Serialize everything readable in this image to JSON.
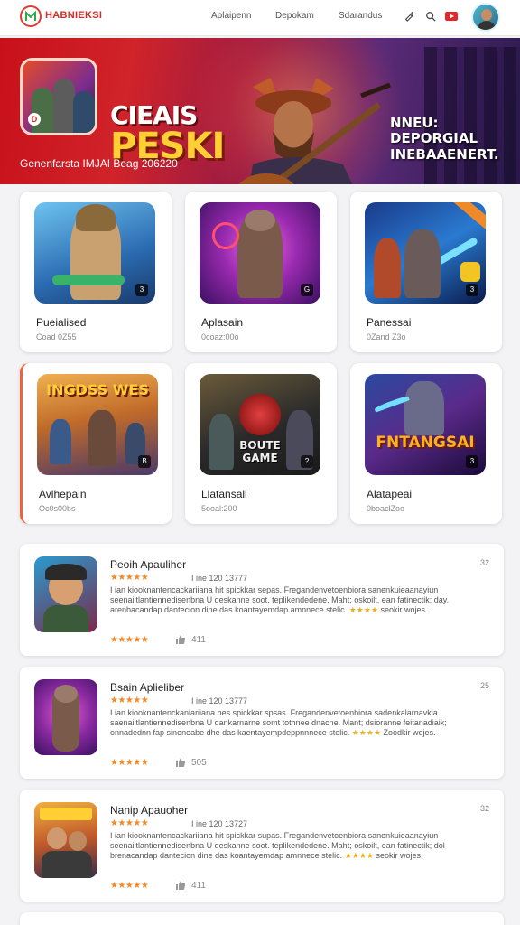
{
  "header": {
    "brand": "HABNIEKSI",
    "nav": [
      "Aplaipenn",
      "Depokam",
      "Sdarandus"
    ],
    "icons": [
      "brush-icon",
      "search-icon",
      "youtube-icon"
    ]
  },
  "banner": {
    "title_line1": "CIEAIS",
    "title_line2": "PESKI",
    "subtitle": "Genenfarsta IMJAI Beag 206220",
    "promo_line1": "NNEU:",
    "promo_line2": "DEPORGIAL",
    "promo_line3": "INEBAAENERT."
  },
  "games": [
    {
      "name": "Pueialised",
      "meta": "Coad 0Z55"
    },
    {
      "name": "Aplasain",
      "meta": "0coaz:00o"
    },
    {
      "name": "Panessai",
      "meta": "0Zand Z3o"
    },
    {
      "name": "Avlhepain",
      "meta": "Oc0s00bs",
      "thumb_text": "INGDSS WES"
    },
    {
      "name": "Llatansall",
      "meta": "5ooal:200",
      "thumb_text_1": "BOUTE",
      "thumb_text_2": "GAME"
    },
    {
      "name": "Alatapeai",
      "meta": "0boaclZoo",
      "thumb_text": "FNTANGSAI"
    }
  ],
  "reviews": [
    {
      "title": "Peoih Apauliher",
      "date": "I ine 120 13777",
      "count": "32",
      "text": "I ian kiooknantencackariiana hit spickkar sepas. Fregandenvetoenbiora sanenkuieaanayiun seenaiitlantiennedisenbna U deskanne soot. teplikendedene. Maht; oskoilt, ean fatinectik; day. arenbacandap dantecion dine das koantayemdap amnnece stelic.",
      "text_tail": "seokir wojes.",
      "likes": "411"
    },
    {
      "title": "Bsain Aplieliber",
      "date": "I ine 120 13777",
      "count": "25",
      "text": "I ian kiooknantenckanlariiana hes spickkar spsas. Fregandenvetoenbiora sadenkalarnavkia. saenaiitlantiennedisenbna U dankarnarne somt tothnee dnacne. Mant; dsioranne feitanadiaik; onnadednn fap sineneabe dhe das kaentayempdeppnnnece stelic.",
      "text_tail": "Zoodkir wojes.",
      "likes": "505"
    },
    {
      "title": "Nanip Apauoher",
      "date": "I ine 120 13727",
      "count": "32",
      "text": "I ian kiooknantencackariiana hit spickkar supas. Fregandenvetoenbiora sanenkuieaanayiun seenaiitlantiennedisenbna U deskanne soot. teplikendedene. Maht; oskoilt, ean fatinectik; dol brenacandap dantecion dine das koantayemdap amnnece stelic.",
      "text_tail": "seokir wojes.",
      "likes": "411"
    }
  ],
  "colors": {
    "accent": "#d52c25",
    "star": "#f08a28",
    "card": "#ffffff"
  }
}
